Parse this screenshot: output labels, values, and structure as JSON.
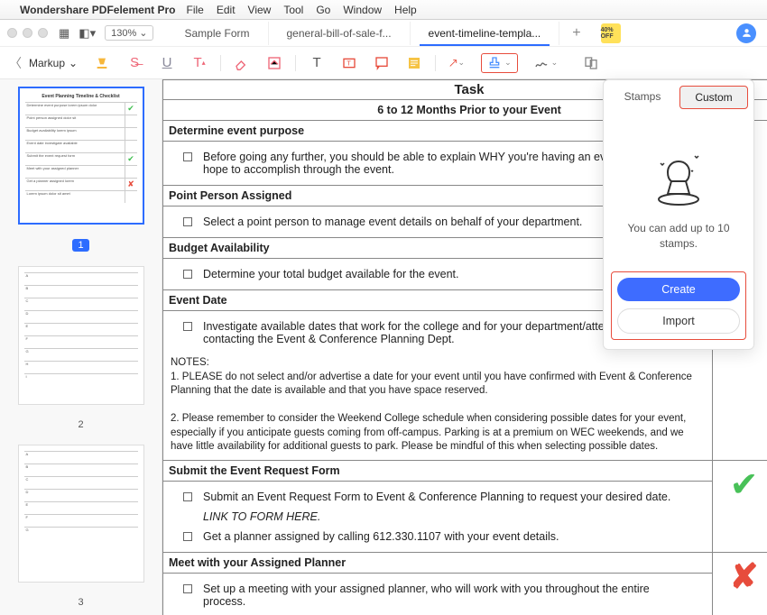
{
  "menubar": {
    "app": "Wondershare PDFelement Pro",
    "items": [
      "File",
      "Edit",
      "View",
      "Tool",
      "Go",
      "Window",
      "Help"
    ]
  },
  "titlebar": {
    "zoom": "130%",
    "tabs": [
      {
        "label": "Sample Form"
      },
      {
        "label": "general-bill-of-sale-f..."
      },
      {
        "label": "event-timeline-templa...",
        "active": true
      }
    ],
    "promo": "40% OFF"
  },
  "toolbar": {
    "markup_label": "Markup"
  },
  "sidebar": {
    "pages": [
      1,
      2,
      3
    ],
    "thumb_title": "Event Planning Timeline & Checklist"
  },
  "doc": {
    "task": "Task",
    "subhead": "6 to 12 Months Prior to your Event",
    "sections": [
      {
        "title": "Determine event purpose",
        "items": [
          {
            "text": "Before going any further, you should be able to explain WHY you're having an event and what you hope to accomplish through the event."
          }
        ]
      },
      {
        "title": "Point Person Assigned",
        "items": [
          {
            "text": "Select a point person to manage event details on behalf of your department."
          }
        ]
      },
      {
        "title": "Budget Availability",
        "items": [
          {
            "text": "Determine your total budget available for the event."
          }
        ]
      },
      {
        "title": "Event Date",
        "items": [
          {
            "text": "Investigate available dates that work for the college and for your department/attendees by contacting the Event & Conference Planning Dept."
          }
        ],
        "notes": "NOTES:\n1.  PLEASE do not select and/or advertise a date for your event until you have confirmed with Event & Conference Planning that the date is available and that you have space reserved.\n\n2.  Please remember to consider the Weekend College schedule when considering possible dates for your event, especially if you anticipate guests coming from off-campus.  Parking is at a premium on WEC weekends, and we have little availability for additional guests to park.  Please be mindful of this when selecting possible dates."
      },
      {
        "title": "Submit the Event Request Form",
        "items": [
          {
            "text": "Submit an Event Request Form to Event & Conference Planning to request your desired date."
          },
          {
            "text": "LINK TO FORM HERE.",
            "link": true
          },
          {
            "text": "Get a planner assigned by calling 612.330.1107 with your event details."
          }
        ],
        "mark": "ok"
      },
      {
        "title": "Meet with your Assigned Planner",
        "items": [
          {
            "text": "Set up a meeting with your assigned planner, who will work with you throughout the entire process."
          }
        ],
        "mark": "no"
      }
    ]
  },
  "panel": {
    "tabs": {
      "stamps": "Stamps",
      "custom": "Custom"
    },
    "message": "You can add up to 10 stamps.",
    "create": "Create",
    "import": "Import"
  }
}
